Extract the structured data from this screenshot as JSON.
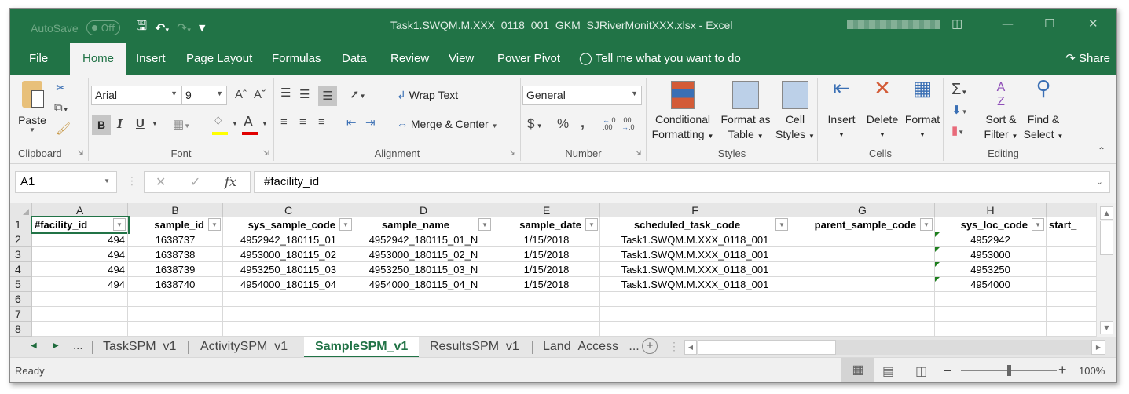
{
  "titlebar": {
    "autosave_label": "AutoSave",
    "autosave_state": "Off",
    "document_title": "Task1.SWQM.M.XXX_0118_001_GKM_SJRiverMonitXXX.xlsx  -  Excel",
    "qat_icons": [
      "save-icon",
      "undo-icon",
      "redo-icon",
      "customize-qat-icon"
    ],
    "window_controls": [
      "ribbon-display-options-icon",
      "minimize-icon",
      "maximize-icon",
      "close-icon"
    ]
  },
  "ribbon_tabs": [
    {
      "label": "File"
    },
    {
      "label": "Home",
      "active": true
    },
    {
      "label": "Insert"
    },
    {
      "label": "Page Layout"
    },
    {
      "label": "Formulas"
    },
    {
      "label": "Data"
    },
    {
      "label": "Review"
    },
    {
      "label": "View"
    },
    {
      "label": "Power Pivot"
    }
  ],
  "tell_me": "Tell me what you want to do",
  "share_label": "Share",
  "ribbon": {
    "clipboard": {
      "label": "Clipboard",
      "paste": "Paste"
    },
    "font": {
      "label": "Font",
      "font_name": "Arial",
      "font_size": "9",
      "bold": "B",
      "italic": "I",
      "underline": "U",
      "font_color_hex": "#e00000",
      "fill_color_hex": "#ffff00"
    },
    "alignment": {
      "label": "Alignment",
      "wrap_text": "Wrap Text",
      "merge_center": "Merge & Center"
    },
    "number": {
      "label": "Number",
      "format": "General",
      "currency": "$",
      "percent": "%",
      "comma": ","
    },
    "styles": {
      "label": "Styles",
      "conditional_1": "Conditional",
      "conditional_2": "Formatting",
      "format_table_1": "Format as",
      "format_table_2": "Table",
      "cell_styles_1": "Cell",
      "cell_styles_2": "Styles"
    },
    "cells": {
      "label": "Cells",
      "insert": "Insert",
      "delete": "Delete",
      "format": "Format"
    },
    "editing": {
      "label": "Editing",
      "sort_1": "Sort &",
      "sort_2": "Filter",
      "find_1": "Find &",
      "find_2": "Select"
    }
  },
  "formula_bar": {
    "name_box": "A1",
    "formula": "#facility_id",
    "fx": "fx"
  },
  "sheet": {
    "columns": [
      "A",
      "B",
      "C",
      "D",
      "E",
      "F",
      "G",
      "H",
      ""
    ],
    "headers": [
      "#facility_id",
      "sample_id",
      "sys_sample_code",
      "sample_name",
      "sample_date",
      "scheduled_task_code",
      "parent_sample_code",
      "sys_loc_code",
      "start_"
    ],
    "rows": [
      [
        "494",
        "1638737",
        "4952942_180115_01",
        "4952942_180115_01_N",
        "1/15/2018",
        "Task1.SWQM.M.XXX_0118_001",
        "",
        "4952942",
        ""
      ],
      [
        "494",
        "1638738",
        "4953000_180115_02",
        "4953000_180115_02_N",
        "1/15/2018",
        "Task1.SWQM.M.XXX_0118_001",
        "",
        "4953000",
        ""
      ],
      [
        "494",
        "1638739",
        "4953250_180115_03",
        "4953250_180115_03_N",
        "1/15/2018",
        "Task1.SWQM.M.XXX_0118_001",
        "",
        "4953250",
        ""
      ],
      [
        "494",
        "1638740",
        "4954000_180115_04",
        "4954000_180115_04_N",
        "1/15/2018",
        "Task1.SWQM.M.XXX_0118_001",
        "",
        "4954000",
        ""
      ]
    ],
    "row_numbers": [
      "1",
      "2",
      "3",
      "4",
      "5",
      "6",
      "7",
      "8"
    ]
  },
  "sheet_tabs": {
    "ellipsis": "...",
    "tabs": [
      {
        "label": "TaskSPM_v1"
      },
      {
        "label": "ActivitySPM_v1"
      },
      {
        "label": "SampleSPM_v1",
        "active": true
      },
      {
        "label": "ResultsSPM_v1"
      },
      {
        "label": "Land_Access_ ..."
      }
    ]
  },
  "status_bar": {
    "status": "Ready",
    "zoom": "100%",
    "zoom_level_percent": 100
  }
}
